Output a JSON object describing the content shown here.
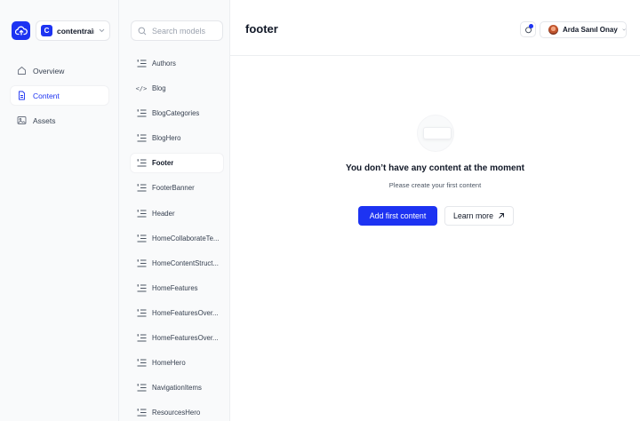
{
  "project": {
    "badge": "C",
    "name": "contentrain-..."
  },
  "nav": [
    {
      "label": "Overview",
      "icon": "home-icon",
      "active": false
    },
    {
      "label": "Content",
      "icon": "document-icon",
      "active": true
    },
    {
      "label": "Assets",
      "icon": "image-icon",
      "active": false
    }
  ],
  "search": {
    "placeholder": "Search models",
    "value": ""
  },
  "models": [
    {
      "label": "Authors",
      "icon": "list-icon"
    },
    {
      "label": "Blog",
      "icon": "code-icon"
    },
    {
      "label": "BlogCategories",
      "icon": "list-icon"
    },
    {
      "label": "BlogHero",
      "icon": "list-icon"
    },
    {
      "label": "Footer",
      "icon": "list-icon",
      "active": true
    },
    {
      "label": "FooterBanner",
      "icon": "list-icon"
    },
    {
      "label": "Header",
      "icon": "list-icon"
    },
    {
      "label": "HomeCollaborateTe...",
      "icon": "list-icon"
    },
    {
      "label": "HomeContentStruct...",
      "icon": "list-icon"
    },
    {
      "label": "HomeFeatures",
      "icon": "list-icon"
    },
    {
      "label": "HomeFeaturesOver...",
      "icon": "list-icon"
    },
    {
      "label": "HomeFeaturesOver...",
      "icon": "list-icon"
    },
    {
      "label": "HomeHero",
      "icon": "list-icon"
    },
    {
      "label": "NavigationItems",
      "icon": "list-icon"
    },
    {
      "label": "ResourcesHero",
      "icon": "list-icon"
    }
  ],
  "header": {
    "title": "footer",
    "user_name": "Arda Sanıl Onay"
  },
  "empty_state": {
    "title": "You don’t have any content at the moment",
    "subtitle": "Please create your first content",
    "primary_label": "Add first content",
    "secondary_label": "Learn more"
  },
  "colors": {
    "accent": "#1d33f2",
    "border": "#e5e7eb",
    "sidebar_bg": "#f9fafb"
  }
}
